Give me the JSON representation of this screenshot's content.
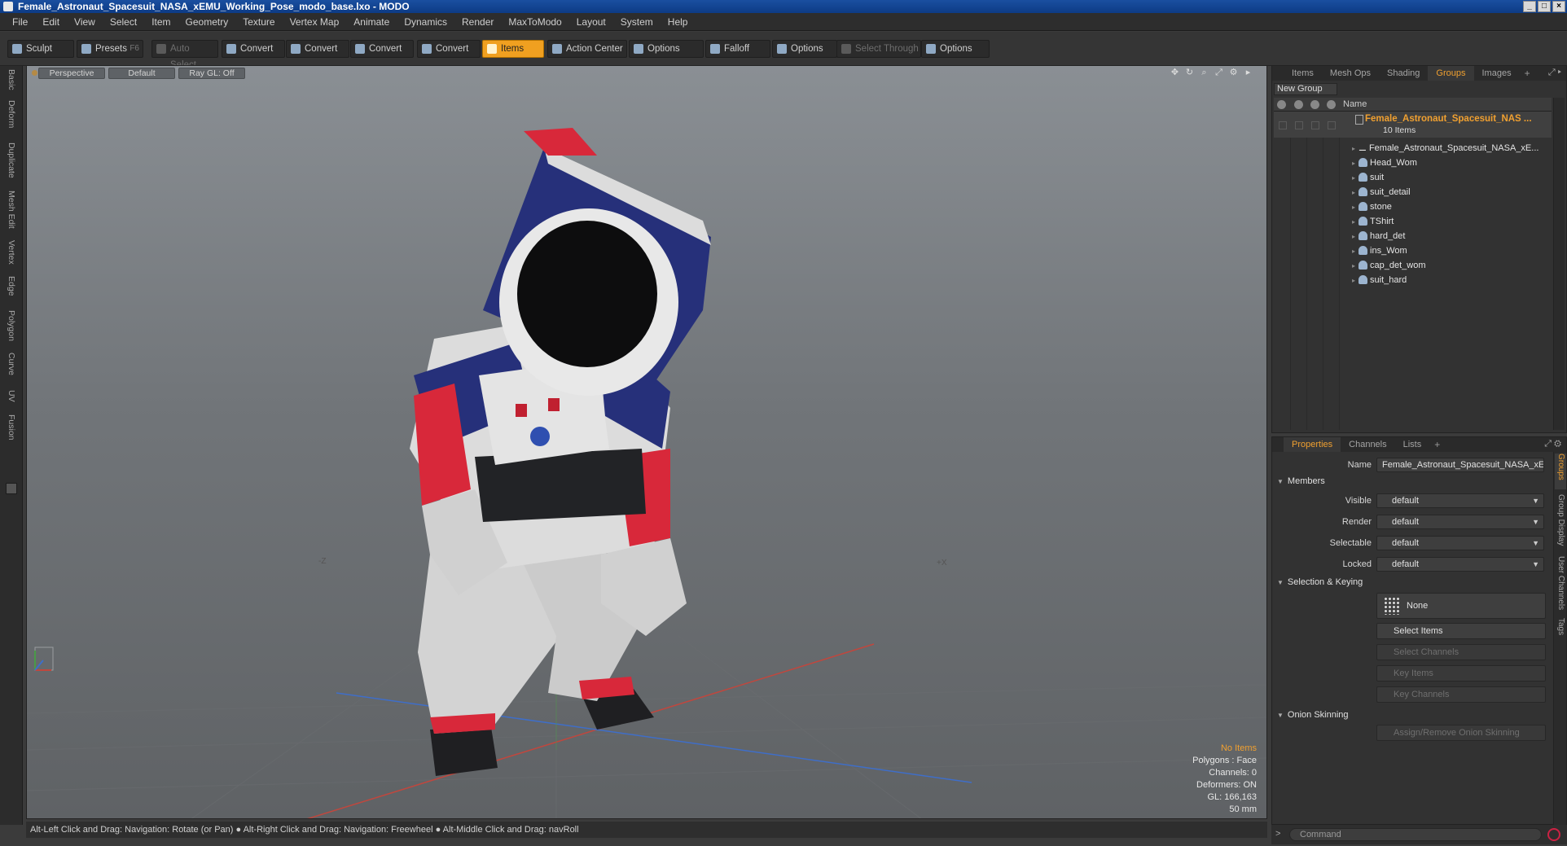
{
  "window": {
    "title": "Female_Astronaut_Spacesuit_NASA_xEMU_Working_Pose_modo_base.lxo - MODO",
    "buttons": [
      "_",
      "□",
      "×"
    ]
  },
  "menu": [
    "File",
    "Edit",
    "View",
    "Select",
    "Item",
    "Geometry",
    "Texture",
    "Vertex Map",
    "Animate",
    "Dynamics",
    "Render",
    "MaxToModo",
    "Layout",
    "System",
    "Help"
  ],
  "toolbar": {
    "sculpt": "Sculpt",
    "presets": "Presets",
    "presets_hotkey": "F6",
    "auto_select": "Auto Select",
    "convert_1": "Convert",
    "convert_2": "Convert",
    "convert_3": "Convert",
    "convert_4": "Convert",
    "items": "Items",
    "action_center": "Action Center",
    "options_1": "Options",
    "falloff": "Falloff",
    "options_2": "Options",
    "select_through": "Select Through",
    "options_3": "Options"
  },
  "left_tabs": [
    "Basic",
    "Deform",
    "Duplicate",
    "Mesh Edit",
    "Vertex",
    "Edge",
    "Polygon",
    "Curve",
    "UV",
    "Fusion"
  ],
  "viewport": {
    "view": "Perspective",
    "shading": "Default",
    "raygl": "Ray GL: Off",
    "axis_neg_z": "-Z",
    "axis_pos_x": "+X",
    "stats": {
      "selection": "No Items",
      "polygons": "Polygons : Face",
      "channels": "Channels: 0",
      "deformers": "Deformers: ON",
      "gl": "GL: 166,163",
      "focal": "50 mm"
    }
  },
  "status_bar": "Alt-Left Click and Drag: Navigation: Rotate (or Pan) ● Alt-Right Click and Drag: Navigation: Freewheel ● Alt-Middle Click and Drag: navRoll",
  "items_panel": {
    "tabs": [
      "Items",
      "Mesh Ops",
      "Shading",
      "Groups",
      "Images"
    ],
    "active_tab": "Groups",
    "new_group": "New Group",
    "column_name": "Name",
    "group_name": "Female_Astronaut_Spacesuit_NAS ...",
    "group_count": "10 Items",
    "items": [
      "Female_Astronaut_Spacesuit_NASA_xE...",
      "Head_Wom",
      "suit",
      "suit_detail",
      "stone",
      "TShirt",
      "hard_det",
      "ins_Wom",
      "cap_det_wom",
      "suit_hard"
    ]
  },
  "properties_panel": {
    "tabs": [
      "Properties",
      "Channels",
      "Lists"
    ],
    "active_tab": "Properties",
    "name_label": "Name",
    "name_value": "Female_Astronaut_Spacesuit_NASA_xEM",
    "members_section": "Members",
    "visible_label": "Visible",
    "visible_value": "default",
    "render_label": "Render",
    "render_value": "default",
    "selectable_label": "Selectable",
    "selectable_value": "default",
    "locked_label": "Locked",
    "locked_value": "default",
    "selection_section": "Selection & Keying",
    "none_btn": "None",
    "select_items": "Select Items",
    "select_channels": "Select Channels",
    "key_items": "Key Items",
    "key_channels": "Key Channels",
    "onion_section": "Onion Skinning",
    "assign_onion": "Assign/Remove Onion Skinning",
    "side_tabs": [
      "Groups",
      "Group Display",
      "User Channels",
      "Tags"
    ]
  },
  "command": {
    "prompt": ">",
    "placeholder": "Command"
  },
  "colors": {
    "accent": "#f0a030",
    "title_bar": "#0d3b85",
    "viewport_top": "#8a8f94",
    "viewport_bottom": "#5f6265",
    "suit_red": "#d8283a",
    "suit_blue": "#26307a"
  }
}
